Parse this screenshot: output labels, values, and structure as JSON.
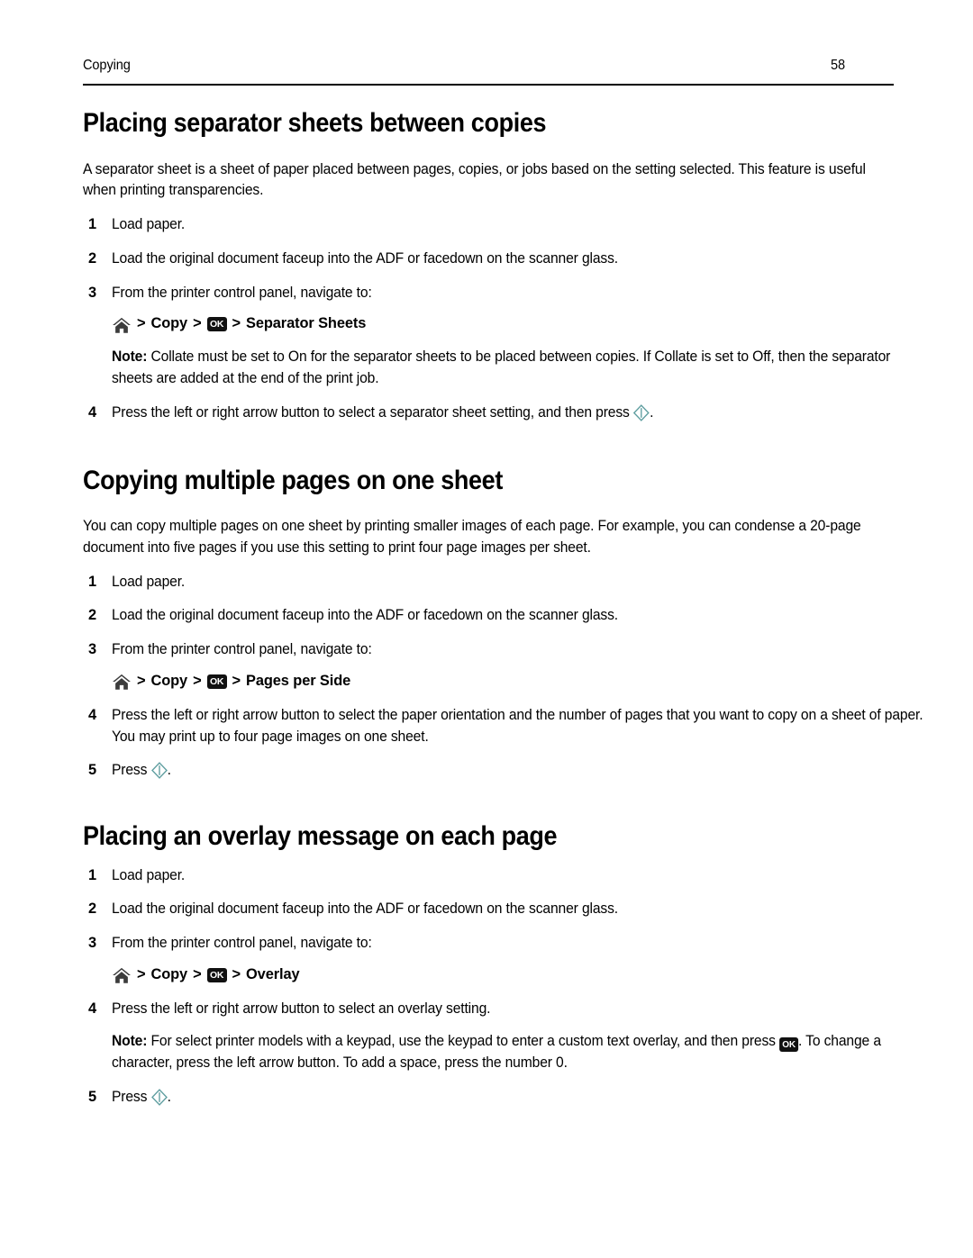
{
  "header": {
    "chapter": "Copying",
    "page_number": "58"
  },
  "icons": {
    "home": "home-icon",
    "ok": "OK",
    "start": "start-icon"
  },
  "colors": {
    "text": "#000000",
    "rule": "#000000",
    "ok_button_bg": "#111111",
    "ok_button_fg": "#ffffff",
    "start_icon": "#5f9ea0",
    "home_icon": "#3c3c3c"
  },
  "sections": [
    {
      "title": "Placing separator sheets between copies",
      "intro": "A separator sheet is a sheet of paper placed between pages, copies, or jobs based on the setting selected. This feature is useful when printing transparencies.",
      "steps": [
        {
          "num": "1",
          "text": "Load paper."
        },
        {
          "num": "2",
          "text": "Load the original document faceup into the ADF or facedown on the scanner glass."
        },
        {
          "num": "3",
          "text": "From the printer control panel, navigate to:"
        },
        {
          "num": "4",
          "text_before": "Press the left or right arrow button to select a separator sheet setting, and then press ",
          "text_after": "."
        }
      ],
      "nav_path": {
        "copy_label": "Copy",
        "target_label": "Separator Sheets",
        "separator": ">"
      },
      "note": {
        "label": "Note:",
        "text": " Collate must be set to On for the separator sheets to be placed between copies. If Collate is set to Off, then the separator sheets are added at the end of the print job."
      }
    },
    {
      "title": "Copying multiple pages on one sheet",
      "intro": "You can copy multiple pages on one sheet by printing smaller images of each page. For example, you can condense a 20-page document into five pages if you use this setting to print four page images per sheet.",
      "steps": [
        {
          "num": "1",
          "text": "Load paper."
        },
        {
          "num": "2",
          "text": "Load the original document faceup into the ADF or facedown on the scanner glass."
        },
        {
          "num": "3",
          "text": "From the printer control panel, navigate to:"
        },
        {
          "num": "4",
          "text": "Press the left or right arrow button to select the paper orientation and the number of pages that you want to copy on a sheet of paper. You may print up to four page images on one sheet."
        },
        {
          "num": "5",
          "text_before": "Press ",
          "text_after": "."
        }
      ],
      "nav_path": {
        "copy_label": "Copy",
        "target_label": "Pages per Side",
        "separator": ">"
      }
    },
    {
      "title": "Placing an overlay message on each page",
      "steps": [
        {
          "num": "1",
          "text": "Load paper."
        },
        {
          "num": "2",
          "text": "Load the original document faceup into the ADF or facedown on the scanner glass."
        },
        {
          "num": "3",
          "text": "From the printer control panel, navigate to:"
        },
        {
          "num": "4",
          "text": "Press the left or right arrow button to select an overlay setting."
        },
        {
          "num": "5",
          "text_before": "Press ",
          "text_after": "."
        }
      ],
      "nav_path": {
        "copy_label": "Copy",
        "target_label": "Overlay",
        "separator": ">"
      },
      "note": {
        "label": "Note:",
        "text_before": " For select printer models with a keypad, use the keypad to enter a custom text overlay, and then press ",
        "text_after": ". To change a character, press the left arrow button. To add a space, press the number 0."
      }
    }
  ]
}
